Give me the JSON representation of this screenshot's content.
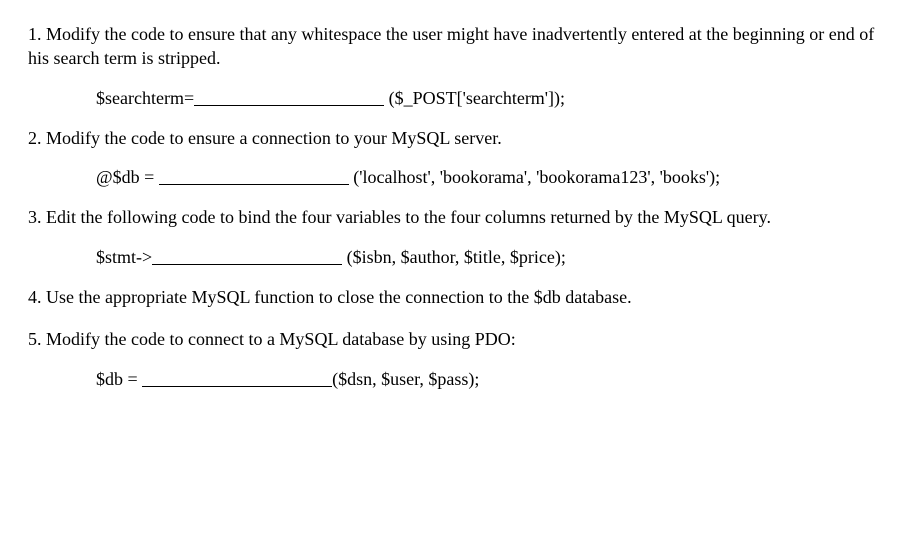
{
  "q1": {
    "text": "1. Modify the code to ensure that any whitespace the user might have inadvertently entered at the beginning or end of his search term is stripped.",
    "code_left": "$searchterm=",
    "code_right": "($_POST['searchterm']);"
  },
  "q2": {
    "text": "2. Modify the code to ensure a connection to your MySQL server.",
    "code_left": "@$db = ",
    "code_right": "('localhost', 'bookorama', 'bookorama123', 'books');"
  },
  "q3": {
    "text": "3. Edit the following code to bind the four variables to the four columns returned by the MySQL query.",
    "code_left": "$stmt->",
    "code_right": "($isbn, $author, $title, $price);"
  },
  "q4": {
    "text": "4. Use the appropriate MySQL function to close the connection to the $db database."
  },
  "q5": {
    "text": "5. Modify the code to connect to a MySQL database by using PDO:",
    "code_left": "$db = ",
    "code_right": "($dsn, $user, $pass);"
  }
}
